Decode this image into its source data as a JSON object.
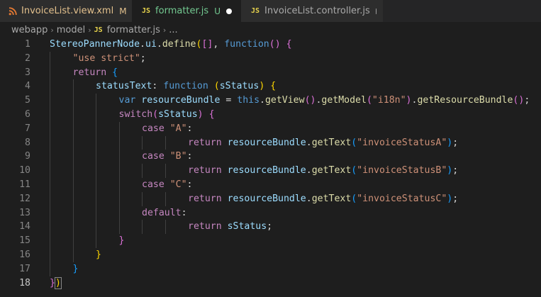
{
  "tabs": [
    {
      "icon": "rss-icon",
      "name": "InvoiceList.view.xml",
      "status": "M",
      "active": false,
      "color": "#e2c08d"
    },
    {
      "icon_text": "JS",
      "name": "formatter.js",
      "status": "U",
      "active": true,
      "color": "#73c991"
    },
    {
      "icon_text": "JS",
      "name": "InvoiceList.controller.js",
      "status": "",
      "active": false,
      "color": "#a9a9a9"
    }
  ],
  "breadcrumb": {
    "folder1": "webapp",
    "folder2": "model",
    "file_icon": "JS",
    "file": "formatter.js",
    "separator": "›",
    "ellipsis": "..."
  },
  "editor": {
    "current_line": 18,
    "lines": [
      {
        "n": "1",
        "indent": 0,
        "tokens": [
          [
            "StereoPannerNode",
            "var"
          ],
          [
            ".",
            "pun"
          ],
          [
            "ui",
            "var"
          ],
          [
            ".",
            "pun"
          ],
          [
            "define",
            "fn"
          ],
          [
            "(",
            "b1"
          ],
          [
            "[]",
            "b2"
          ],
          [
            ", ",
            "pun"
          ],
          [
            "function",
            "kw"
          ],
          [
            "()",
            "b2"
          ],
          [
            " ",
            "pun"
          ],
          [
            "{",
            "b2"
          ]
        ]
      },
      {
        "n": "2",
        "indent": 1,
        "tokens": [
          [
            "\"use strict\"",
            "str"
          ],
          [
            ";",
            "pun"
          ]
        ]
      },
      {
        "n": "3",
        "indent": 1,
        "tokens": [
          [
            "return",
            "ctrl"
          ],
          [
            " ",
            "pun"
          ],
          [
            "{",
            "b3"
          ]
        ]
      },
      {
        "n": "4",
        "indent": 2,
        "tokens": [
          [
            "statusText",
            "var"
          ],
          [
            ": ",
            "pun"
          ],
          [
            "function",
            "kw"
          ],
          [
            " ",
            "pun"
          ],
          [
            "(",
            "b1"
          ],
          [
            "sStatus",
            "var"
          ],
          [
            ")",
            "b1"
          ],
          [
            " ",
            "pun"
          ],
          [
            "{",
            "b1"
          ]
        ]
      },
      {
        "n": "5",
        "indent": 3,
        "tokens": [
          [
            "var",
            "kw"
          ],
          [
            " ",
            "pun"
          ],
          [
            "resourceBundle",
            "var"
          ],
          [
            " = ",
            "pun"
          ],
          [
            "this",
            "kw"
          ],
          [
            ".",
            "pun"
          ],
          [
            "getView",
            "fn"
          ],
          [
            "()",
            "b2"
          ],
          [
            ".",
            "pun"
          ],
          [
            "getModel",
            "fn"
          ],
          [
            "(",
            "b2"
          ],
          [
            "\"i18n\"",
            "str"
          ],
          [
            ")",
            "b2"
          ],
          [
            ".",
            "pun"
          ],
          [
            "getResourceBundle",
            "fn"
          ],
          [
            "()",
            "b2"
          ],
          [
            ";",
            "pun"
          ]
        ]
      },
      {
        "n": "6",
        "indent": 3,
        "tokens": [
          [
            "switch",
            "ctrl"
          ],
          [
            "(",
            "b2"
          ],
          [
            "sStatus",
            "var"
          ],
          [
            ")",
            "b2"
          ],
          [
            " ",
            "pun"
          ],
          [
            "{",
            "b2"
          ]
        ]
      },
      {
        "n": "7",
        "indent": 4,
        "tokens": [
          [
            "case",
            "ctrl"
          ],
          [
            " ",
            "pun"
          ],
          [
            "\"A\"",
            "str"
          ],
          [
            ":",
            "pun"
          ]
        ]
      },
      {
        "n": "8",
        "indent": 6,
        "tokens": [
          [
            "return",
            "ctrl"
          ],
          [
            " ",
            "pun"
          ],
          [
            "resourceBundle",
            "var"
          ],
          [
            ".",
            "pun"
          ],
          [
            "getText",
            "fn"
          ],
          [
            "(",
            "b3"
          ],
          [
            "\"invoiceStatusA\"",
            "str"
          ],
          [
            ")",
            "b3"
          ],
          [
            ";",
            "pun"
          ]
        ]
      },
      {
        "n": "9",
        "indent": 4,
        "tokens": [
          [
            "case",
            "ctrl"
          ],
          [
            " ",
            "pun"
          ],
          [
            "\"B\"",
            "str"
          ],
          [
            ":",
            "pun"
          ]
        ]
      },
      {
        "n": "10",
        "indent": 6,
        "tokens": [
          [
            "return",
            "ctrl"
          ],
          [
            " ",
            "pun"
          ],
          [
            "resourceBundle",
            "var"
          ],
          [
            ".",
            "pun"
          ],
          [
            "getText",
            "fn"
          ],
          [
            "(",
            "b3"
          ],
          [
            "\"invoiceStatusB\"",
            "str"
          ],
          [
            ")",
            "b3"
          ],
          [
            ";",
            "pun"
          ]
        ]
      },
      {
        "n": "11",
        "indent": 4,
        "tokens": [
          [
            "case",
            "ctrl"
          ],
          [
            " ",
            "pun"
          ],
          [
            "\"C\"",
            "str"
          ],
          [
            ":",
            "pun"
          ]
        ]
      },
      {
        "n": "12",
        "indent": 6,
        "tokens": [
          [
            "return",
            "ctrl"
          ],
          [
            " ",
            "pun"
          ],
          [
            "resourceBundle",
            "var"
          ],
          [
            ".",
            "pun"
          ],
          [
            "getText",
            "fn"
          ],
          [
            "(",
            "b3"
          ],
          [
            "\"invoiceStatusC\"",
            "str"
          ],
          [
            ")",
            "b3"
          ],
          [
            ";",
            "pun"
          ]
        ]
      },
      {
        "n": "13",
        "indent": 4,
        "tokens": [
          [
            "default",
            "ctrl"
          ],
          [
            ":",
            "pun"
          ]
        ]
      },
      {
        "n": "14",
        "indent": 6,
        "tokens": [
          [
            "return",
            "ctrl"
          ],
          [
            " ",
            "pun"
          ],
          [
            "sStatus",
            "var"
          ],
          [
            ";",
            "pun"
          ]
        ]
      },
      {
        "n": "15",
        "indent": 3,
        "tokens": [
          [
            "}",
            "b2"
          ]
        ]
      },
      {
        "n": "16",
        "indent": 2,
        "tokens": [
          [
            "}",
            "b1"
          ]
        ]
      },
      {
        "n": "17",
        "indent": 1,
        "tokens": [
          [
            "}",
            "b3"
          ]
        ]
      },
      {
        "n": "18",
        "indent": 0,
        "tokens": [
          [
            "}",
            "b2"
          ],
          [
            ")",
            "b1"
          ]
        ]
      }
    ]
  },
  "colors": {
    "editor_bg": "#1e1e1e",
    "tab_bar_bg": "#252526",
    "modified_color": "#e2c08d",
    "untracked_color": "#73c991",
    "js_icon_color": "#e8d44d",
    "xml_icon_color": "#e37933"
  }
}
